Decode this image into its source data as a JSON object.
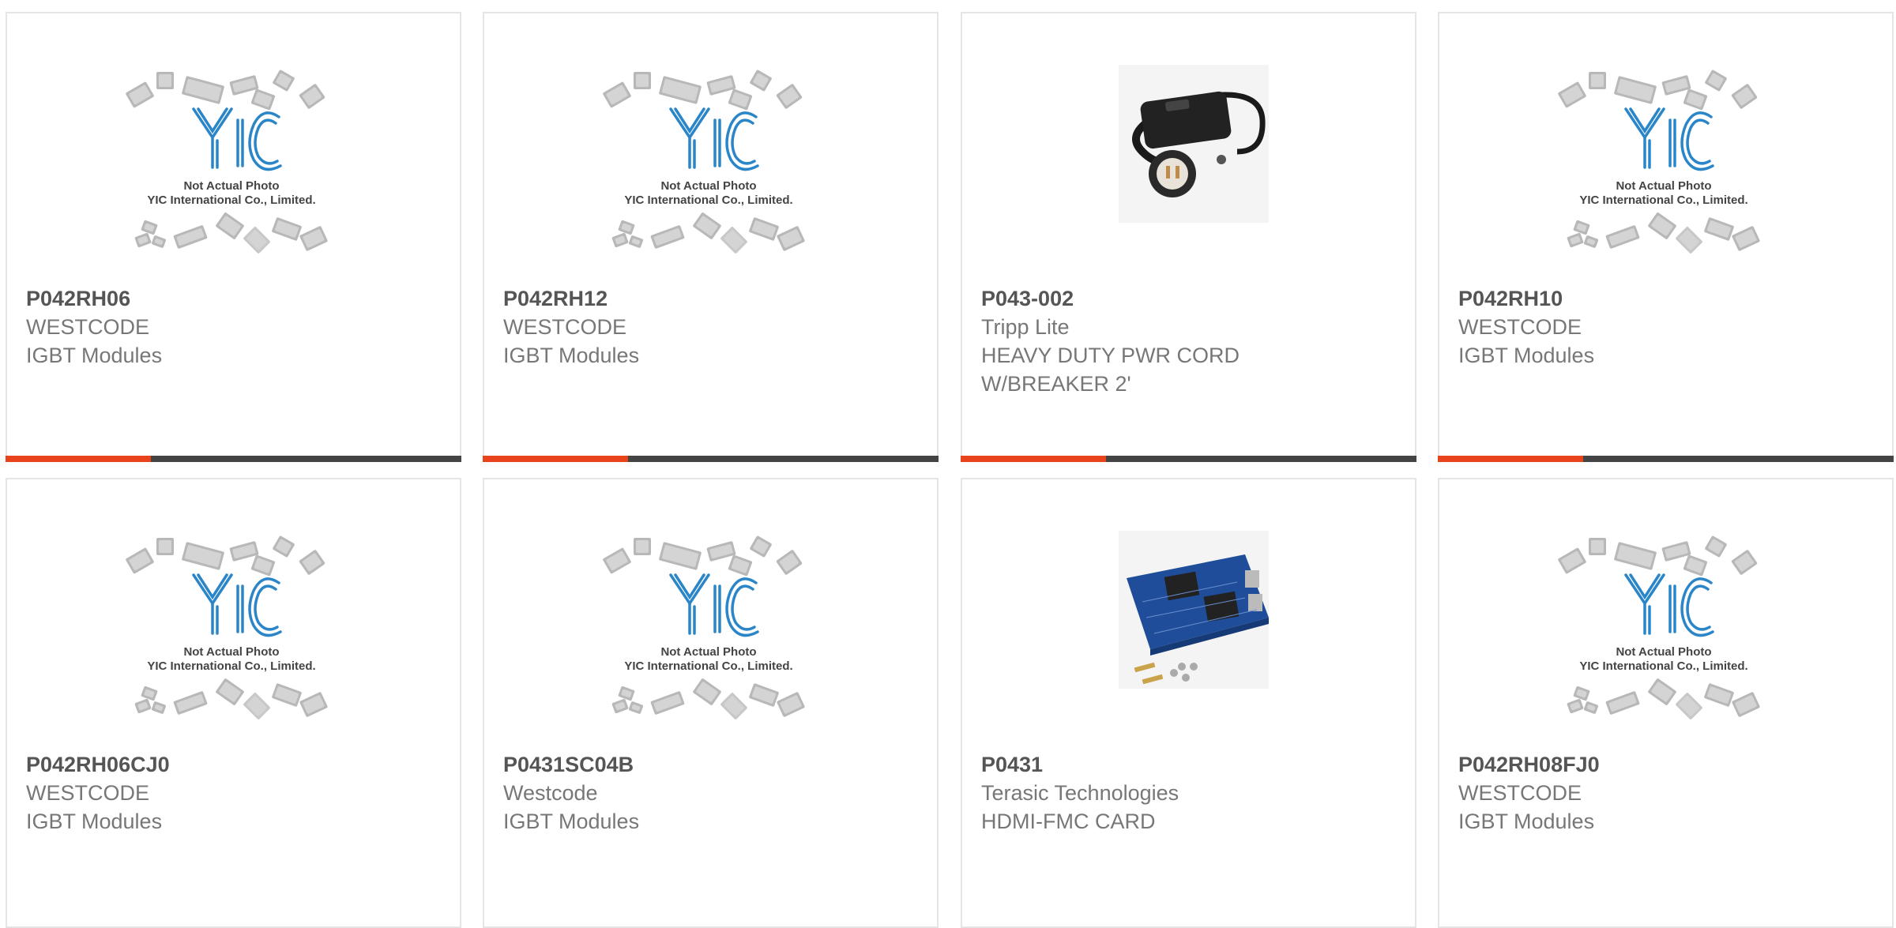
{
  "colors": {
    "accent": "#e8431a",
    "bar_dark": "#444444",
    "yic_blue": "#2a86c8",
    "chip_gray": "#b8b8b8"
  },
  "placeholder": {
    "line1": "Not Actual Photo",
    "line2": "YIC International Co., Limited."
  },
  "products": [
    {
      "part": "P042RH06",
      "manufacturer": "WESTCODE",
      "desc1": "IGBT Modules",
      "desc2": "",
      "image": "yic-placeholder"
    },
    {
      "part": "P042RH12",
      "manufacturer": "WESTCODE",
      "desc1": "IGBT Modules",
      "desc2": "",
      "image": "yic-placeholder"
    },
    {
      "part": "P043-002",
      "manufacturer": "Tripp Lite",
      "desc1": "HEAVY DUTY PWR CORD",
      "desc2": "W/BREAKER 2'",
      "image": "power-cord-photo"
    },
    {
      "part": "P042RH10",
      "manufacturer": "WESTCODE",
      "desc1": "IGBT Modules",
      "desc2": "",
      "image": "yic-placeholder"
    },
    {
      "part": "P042RH06CJ0",
      "manufacturer": "WESTCODE",
      "desc1": "IGBT Modules",
      "desc2": "",
      "image": "yic-placeholder"
    },
    {
      "part": "P0431SC04B",
      "manufacturer": "Westcode",
      "desc1": "IGBT Modules",
      "desc2": "",
      "image": "yic-placeholder"
    },
    {
      "part": "P0431",
      "manufacturer": "Terasic Technologies",
      "desc1": "HDMI-FMC CARD",
      "desc2": "",
      "image": "circuit-board-photo"
    },
    {
      "part": "P042RH08FJ0",
      "manufacturer": "WESTCODE",
      "desc1": "IGBT Modules",
      "desc2": "",
      "image": "yic-placeholder"
    }
  ]
}
